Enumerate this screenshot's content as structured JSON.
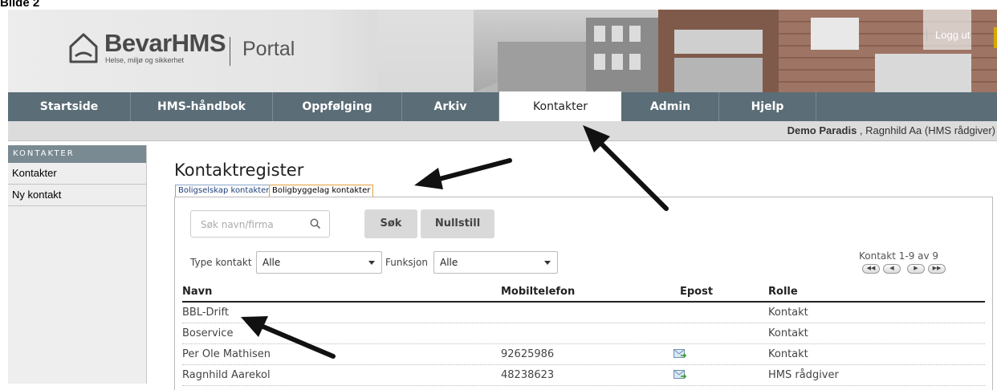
{
  "caption": "Bilde 2",
  "header": {
    "brand": "BevarHMS",
    "brand_sub": "Helse, miljø og sikkerhet",
    "portal": "Portal",
    "logout": "Logg ut"
  },
  "nav": {
    "items": [
      "Startside",
      "HMS-håndbok",
      "Oppfølging",
      "Arkiv",
      "Kontakter",
      "Admin",
      "Hjelp"
    ],
    "active": "Kontakter"
  },
  "user": {
    "org": "Demo Paradis",
    "rest": " , Ragnhild Aa (HMS rådgiver)"
  },
  "sidebar": {
    "heading": "KONTAKTER",
    "items": [
      "Kontakter",
      "Ny kontakt"
    ]
  },
  "main": {
    "title": "Kontaktregister",
    "tabs": [
      "Boligselskap kontakter",
      "Boligbyggelag kontakter"
    ],
    "active_tab": "Boligbyggelag kontakter",
    "search_placeholder": "Søk navn/firma",
    "search_button": "Søk",
    "reset_button": "Nullstill",
    "filter_type_label": "Type kontakt",
    "filter_type_value": "Alle",
    "filter_function_label": "Funksjon",
    "filter_function_value": "Alle",
    "pagination": "Kontakt 1-9 av 9",
    "pager_buttons": [
      "first",
      "previous",
      "next",
      "last"
    ]
  },
  "table": {
    "columns": [
      "Navn",
      "Mobiltelefon",
      "Epost",
      "Rolle"
    ],
    "rows": [
      {
        "name": "BBL-Drift",
        "phone": "",
        "email": false,
        "role": "Kontakt"
      },
      {
        "name": "Boservice",
        "phone": "",
        "email": false,
        "role": "Kontakt"
      },
      {
        "name": "Per Ole Mathisen",
        "phone": "92625986",
        "email": true,
        "role": "Kontakt"
      },
      {
        "name": "Ragnhild Aarekol",
        "phone": "48238623",
        "email": true,
        "role": "HMS rådgiver"
      }
    ]
  },
  "icons": {
    "logo": "house-logo-icon",
    "search": "search-icon",
    "email": "email-icon",
    "annotation": "annotation-arrow"
  },
  "colors": {
    "nav_bg": "#5b6d77",
    "sidebar_head": "#7a8a92",
    "active_tab_border": "#e3a13a",
    "tab_border": "#8aa6cc"
  }
}
